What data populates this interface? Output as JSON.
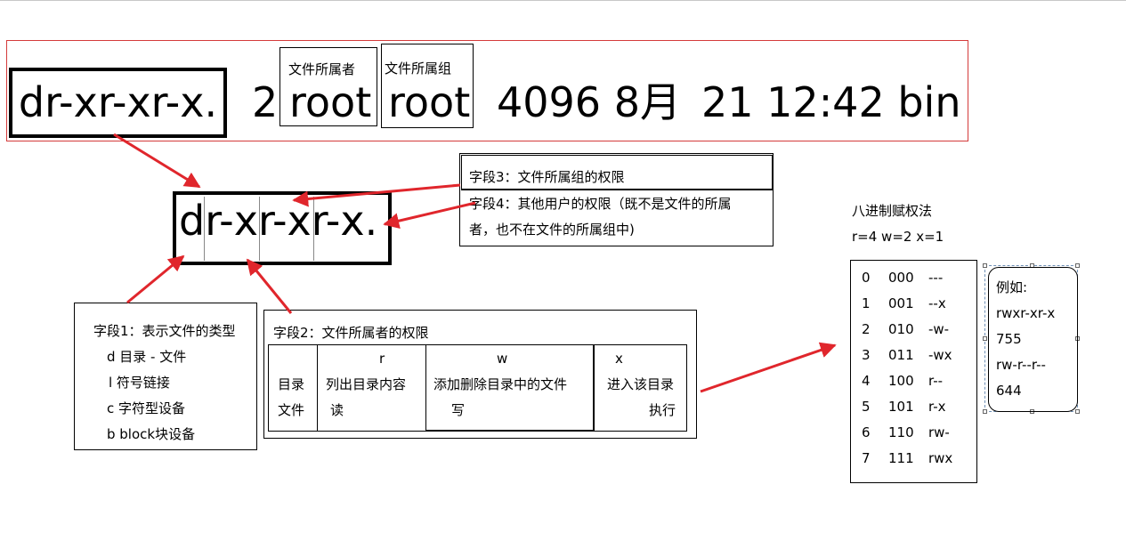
{
  "top_row": {
    "permission": "dr-xr-xr-x.",
    "link_count": "2",
    "owner_label": "文件所属者",
    "owner": "root",
    "group_label": "文件所属组",
    "group": "root",
    "size_date": "4096 8月",
    "day_time_name": "21 12:42 bin"
  },
  "middle": {
    "permission": "dr-xr-xr-x."
  },
  "field3": {
    "text": "字段3：文件所属组的权限"
  },
  "field4": {
    "line1": "字段4：其他用户的权限（既不是文件的所属",
    "line2": "者，也不在文件的所属组中)"
  },
  "field1": {
    "title": "字段1：表示文件的类型",
    "items": [
      "d 目录  - 文件",
      "l 符号链接",
      "c 字符型设备",
      "b block块设备"
    ]
  },
  "field2": {
    "title": "字段2：文件所属者的权限",
    "dir_label_1": "目录",
    "dir_label_2": "文件",
    "r_header": "r",
    "r_desc_1": "列出目录内容",
    "r_desc_2": "读",
    "w_header": "w",
    "w_desc_1": "添加删除目录中的文件",
    "w_desc_2": "写",
    "x_header": "x",
    "x_desc_1": "进入该目录",
    "x_desc_2": "执行"
  },
  "octal": {
    "title": "八进制赋权法",
    "weights": "r=4  w=2  x=1",
    "rows": [
      {
        "dec": "0",
        "bin": "000",
        "perm": "---"
      },
      {
        "dec": "1",
        "bin": "001",
        "perm": "--x"
      },
      {
        "dec": "2",
        "bin": "010",
        "perm": "-w-"
      },
      {
        "dec": "3",
        "bin": "011",
        "perm": "-wx"
      },
      {
        "dec": "4",
        "bin": "100",
        "perm": "r--"
      },
      {
        "dec": "5",
        "bin": "101",
        "perm": "r-x"
      },
      {
        "dec": "6",
        "bin": "110",
        "perm": "rw-"
      },
      {
        "dec": "7",
        "bin": "111",
        "perm": "rwx"
      }
    ]
  },
  "example": {
    "label": "例如:",
    "lines": [
      "rwxr-xr-x",
      "755",
      "rw-r--r--",
      "644"
    ]
  },
  "colors": {
    "arrow": "#e0262c",
    "frame": "#d43a3a"
  }
}
